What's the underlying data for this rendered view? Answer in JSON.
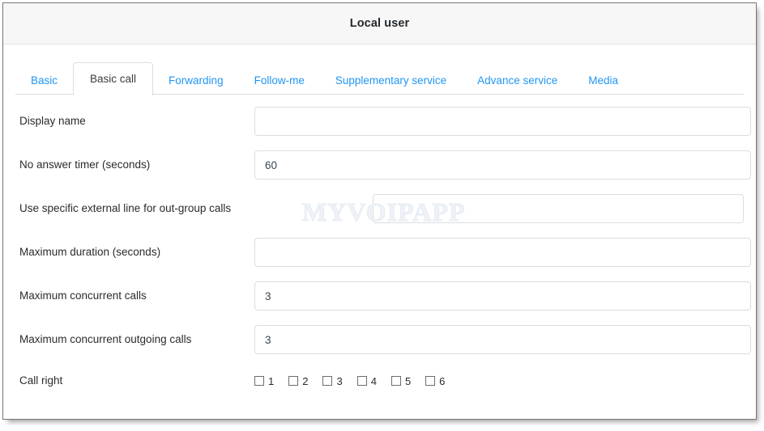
{
  "window": {
    "title": "Local user"
  },
  "watermark": {
    "text": "MYVOIPAPP"
  },
  "tabs": [
    {
      "label": "Basic",
      "active": false
    },
    {
      "label": "Basic call",
      "active": true
    },
    {
      "label": "Forwarding",
      "active": false
    },
    {
      "label": "Follow-me",
      "active": false
    },
    {
      "label": "Supplementary service",
      "active": false
    },
    {
      "label": "Advance service",
      "active": false
    },
    {
      "label": "Media",
      "active": false
    }
  ],
  "form": {
    "rows": [
      {
        "label": "Display name",
        "value": "",
        "placeholder": "",
        "width": "wide"
      },
      {
        "label": "No answer timer (seconds)",
        "value": "60",
        "placeholder": "",
        "width": "wide"
      },
      {
        "label": "Use specific external line for out-group calls",
        "value": "",
        "placeholder": "",
        "width": "narrow"
      },
      {
        "label": "Maximum duration (seconds)",
        "value": "",
        "placeholder": "",
        "width": "wide"
      },
      {
        "label": "Maximum concurrent calls",
        "value": "3",
        "placeholder": "",
        "width": "wide"
      },
      {
        "label": "Maximum concurrent outgoing calls",
        "value": "3",
        "placeholder": "",
        "width": "wide"
      }
    ],
    "call_right": {
      "label": "Call right",
      "options": [
        {
          "label": "1",
          "checked": false
        },
        {
          "label": "2",
          "checked": false
        },
        {
          "label": "3",
          "checked": false
        },
        {
          "label": "4",
          "checked": false
        },
        {
          "label": "5",
          "checked": false
        },
        {
          "label": "6",
          "checked": false
        }
      ]
    }
  },
  "colors": {
    "tab_link": "#2196f3",
    "tab_active_text": "#3c3c3c",
    "label_text": "#2b2b2b",
    "input_border": "#d8dde3",
    "window_border": "#757575",
    "header_bg": "#f7f7f7"
  }
}
